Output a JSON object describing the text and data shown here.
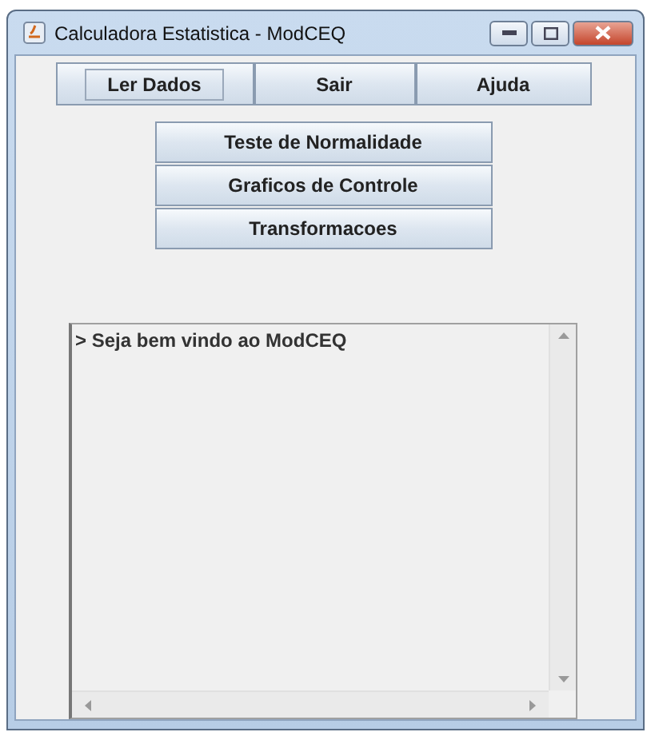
{
  "window": {
    "title": "Calculadora Estatistica - ModCEQ"
  },
  "menu_buttons": [
    {
      "label": "Ler Dados",
      "focused": true
    },
    {
      "label": "Sair",
      "focused": false
    },
    {
      "label": "Ajuda",
      "focused": false
    }
  ],
  "actions": [
    "Teste de Normalidade",
    "Graficos de Controle",
    "Transformacoes"
  ],
  "console": {
    "lines": [
      "> Seja bem vindo ao ModCEQ"
    ]
  }
}
